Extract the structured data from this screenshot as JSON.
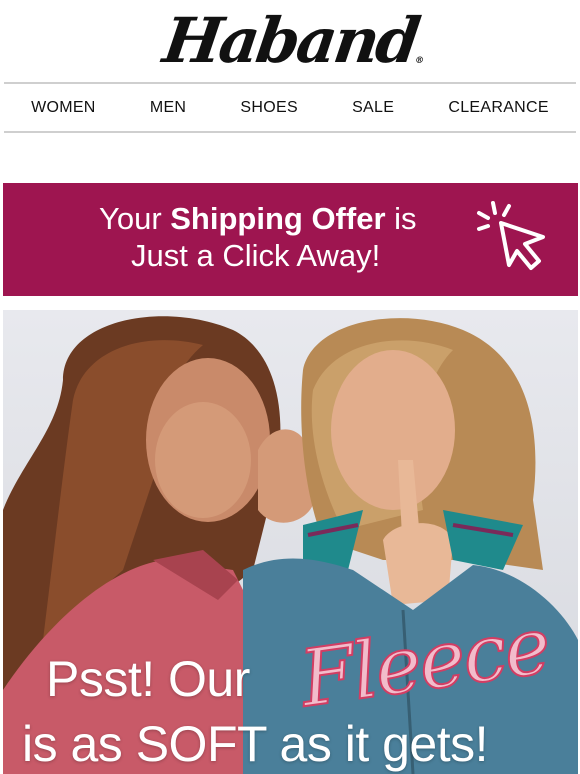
{
  "brand": {
    "name": "Haband",
    "registered_mark": "®"
  },
  "nav": {
    "items": [
      {
        "label": "WOMEN"
      },
      {
        "label": "MEN"
      },
      {
        "label": "SHOES"
      },
      {
        "label": "SALE"
      },
      {
        "label": "CLEARANCE"
      }
    ]
  },
  "banner": {
    "line1_prefix": "Your ",
    "line1_bold": "Shipping Offer",
    "line1_suffix": " is",
    "line2": "Just a Click Away!",
    "icon": "click-cursor-icon",
    "background_color": "#9e1550"
  },
  "hero": {
    "headline_part1": "Psst! Our",
    "headline_accent": "Fleece",
    "headline_part2": "is as SOFT as it gets!",
    "image": "two-women-in-fleece-jackets-whispering"
  }
}
